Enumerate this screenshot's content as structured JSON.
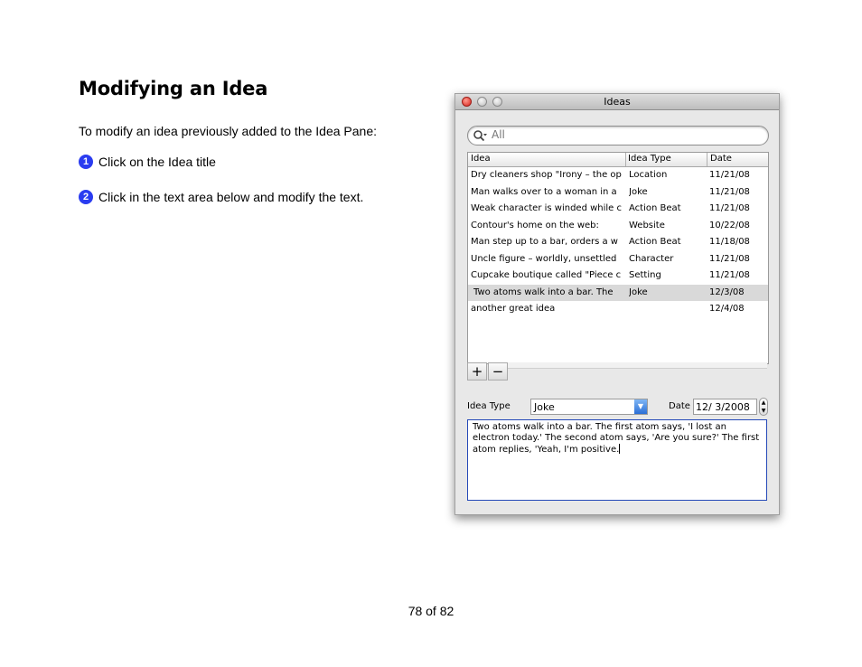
{
  "doc": {
    "title": "Modifying an Idea",
    "intro": "To modify an idea previously added to the Idea Pane:",
    "steps": [
      {
        "num": "1",
        "text": "Click on the Idea title"
      },
      {
        "num": "2",
        "text": "Click in the text area below and modify the text."
      }
    ],
    "page_footer": "78 of 82"
  },
  "window": {
    "title": "Ideas",
    "search_placeholder": "All",
    "columns": [
      "Idea",
      "Idea Type",
      "Date"
    ],
    "rows": [
      {
        "idea": "Dry cleaners shop \"Irony – the op",
        "type": "Location",
        "date": "11/21/08"
      },
      {
        "idea": "Man walks over to a woman in a",
        "type": "Joke",
        "date": "11/21/08"
      },
      {
        "idea": "Weak character is winded while c",
        "type": "Action Beat",
        "date": "11/21/08"
      },
      {
        "idea": "Contour's home on the web:",
        "type": "Website",
        "date": "10/22/08"
      },
      {
        "idea": "Man step up to a bar, orders a w",
        "type": "Action Beat",
        "date": "11/18/08"
      },
      {
        "idea": "Uncle figure – worldly, unsettled",
        "type": "Character",
        "date": "11/21/08"
      },
      {
        "idea": "Cupcake boutique called \"Piece c",
        "type": "Setting",
        "date": "11/21/08"
      },
      {
        "idea": "Two atoms walk into a bar. The",
        "type": "Joke",
        "date": "12/3/08",
        "selected": true
      },
      {
        "idea": "another great idea",
        "type": "",
        "date": "12/4/08"
      }
    ],
    "add_label": "+",
    "remove_label": "−",
    "idea_type_label": "Idea Type",
    "idea_type_value": "Joke",
    "date_label": "Date",
    "date_value": "12/ 3/2008",
    "text_content": " Two atoms walk into a bar. The first atom says, 'I lost an electron today.' The second atom says, 'Are you sure?' The first atom replies, 'Yeah, I'm positive."
  }
}
